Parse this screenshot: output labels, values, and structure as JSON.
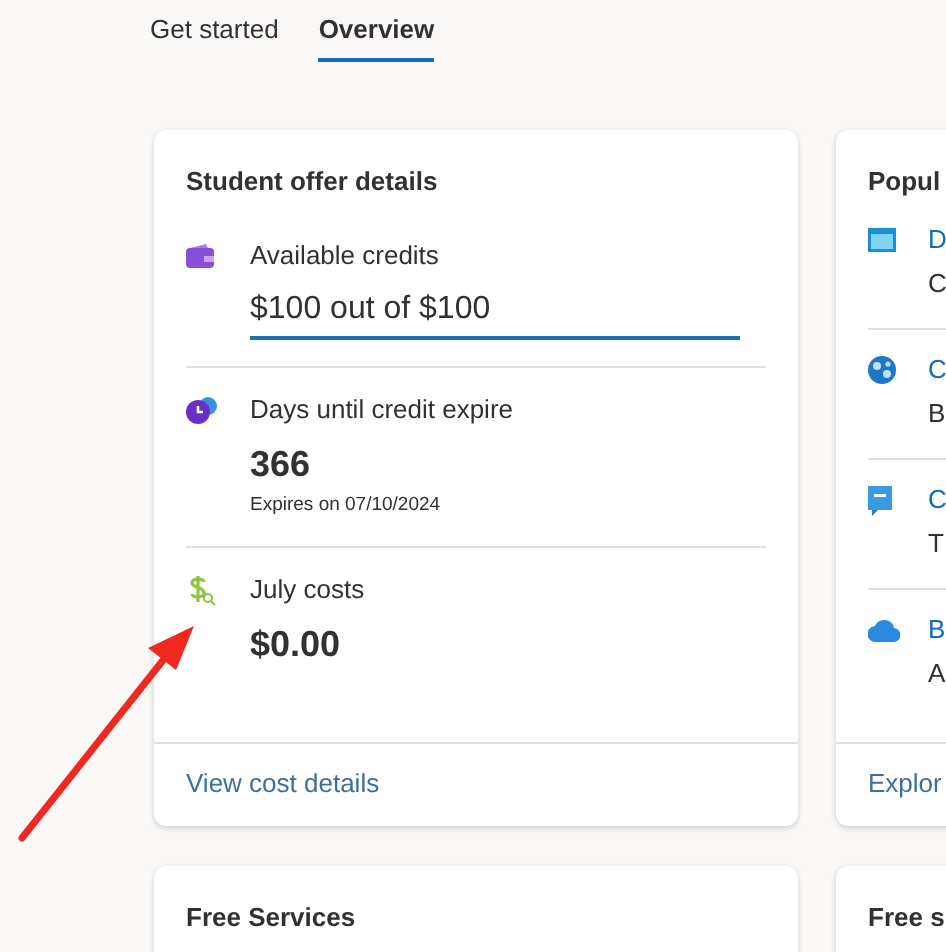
{
  "tabs": [
    {
      "label": "Get started",
      "selected": false
    },
    {
      "label": "Overview",
      "selected": true
    }
  ],
  "offer_card": {
    "title": "Student offer details",
    "metrics": [
      {
        "kind": "credits",
        "label": "Available credits",
        "value": "$100 out of $100",
        "level": 1
      },
      {
        "kind": "days",
        "label": "Days until credit expire",
        "value": "366",
        "note": "Expires on 07/10/2024"
      },
      {
        "kind": "costs",
        "label": "July costs",
        "value": "$0.00"
      }
    ],
    "link": "View cost details"
  },
  "popular_card": {
    "title": "Popul",
    "items": [
      {
        "kind": "calendar",
        "name": "D",
        "description": "C"
      },
      {
        "kind": "globe",
        "name": "C",
        "description": "B"
      },
      {
        "kind": "document",
        "name": "C",
        "description": "T"
      },
      {
        "kind": "cloud",
        "name": "B",
        "description": "A"
      }
    ],
    "link": "Explor"
  },
  "bottom_cards": [
    {
      "title": "Free Services"
    },
    {
      "title": "Free s"
    }
  ],
  "annotation": {
    "kind": "arrow"
  }
}
